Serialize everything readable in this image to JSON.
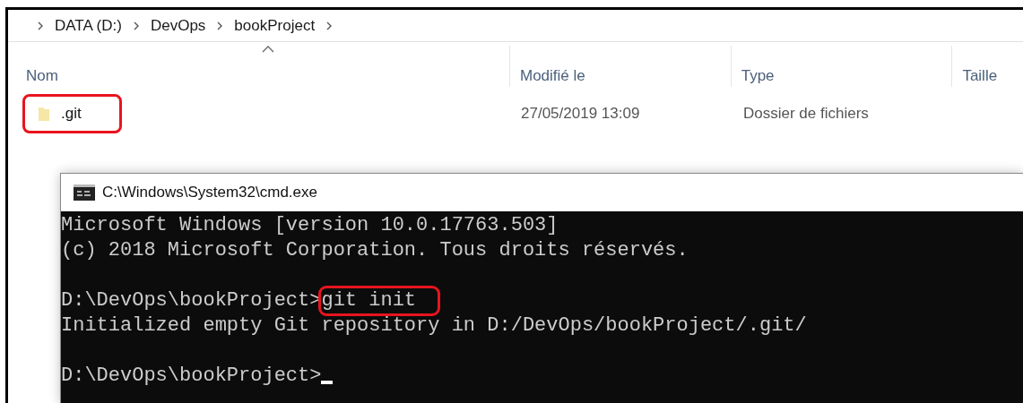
{
  "breadcrumb": [
    "DATA (D:)",
    "DevOps",
    "bookProject"
  ],
  "table": {
    "columns": [
      {
        "label": "Nom",
        "sorted": true
      },
      {
        "label": "Modifié le",
        "sorted": false
      },
      {
        "label": "Type",
        "sorted": false
      },
      {
        "label": "Taille",
        "sorted": false
      }
    ],
    "rows": [
      {
        "name": ".git",
        "modified": "27/05/2019 13:09",
        "type": "Dossier de fichiers",
        "highlighted": true
      }
    ]
  },
  "console": {
    "title": "C:\\Windows\\System32\\cmd.exe",
    "lines": [
      {
        "kind": "output",
        "text": "Microsoft Windows [version 10.0.17763.503]"
      },
      {
        "kind": "output",
        "text": "(c) 2018 Microsoft Corporation. Tous droits réservés."
      },
      {
        "kind": "blank"
      },
      {
        "kind": "command",
        "prompt": "D:\\DevOps\\bookProject>",
        "command": "git init",
        "highlighted": true
      },
      {
        "kind": "output",
        "text": "Initialized empty Git repository in D:/DevOps/bookProject/.git/"
      },
      {
        "kind": "blank"
      },
      {
        "kind": "prompt",
        "prompt": "D:\\DevOps\\bookProject>",
        "cursor": true
      }
    ]
  }
}
